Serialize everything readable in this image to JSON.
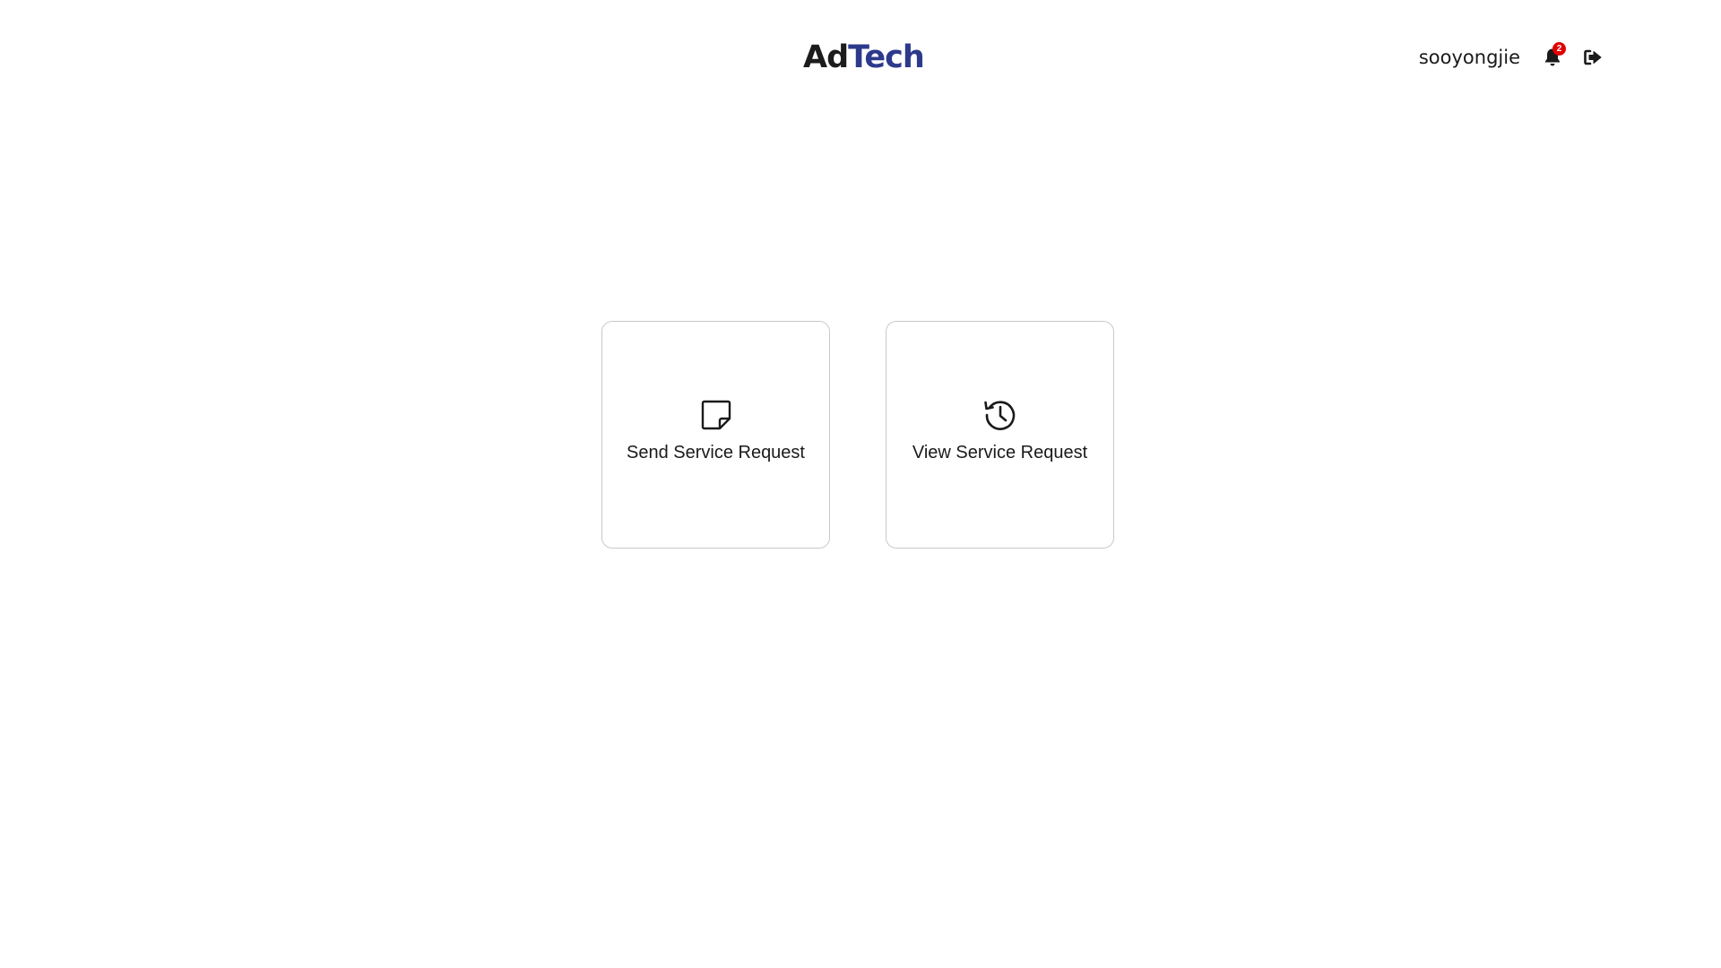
{
  "header": {
    "logo_part1": "Ad",
    "logo_part2": "Tech",
    "username": "sooyongjie",
    "notification_count": "2",
    "notification_icon": "bell-icon",
    "logout_icon": "sign-out-icon"
  },
  "colors": {
    "brand_dark": "#1c1c1c",
    "brand_blue": "#2d3a8c",
    "badge": "#e00000",
    "card_border": "#c9c9c9"
  },
  "cards": [
    {
      "label": "Send Service Request",
      "icon": "sticky-note-icon"
    },
    {
      "label": "View Service Request",
      "icon": "history-icon"
    }
  ]
}
